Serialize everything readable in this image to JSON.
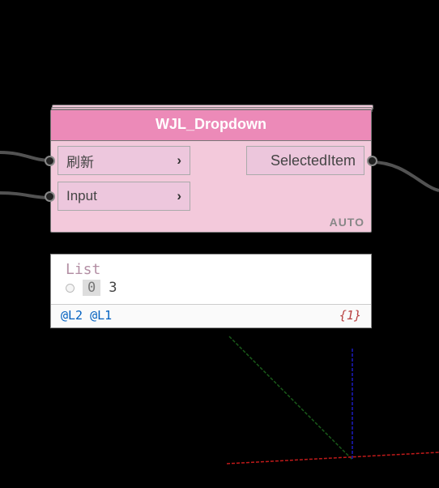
{
  "node": {
    "title": "WJL_Dropdown",
    "inputs": [
      {
        "label": "刷新"
      },
      {
        "label": "Input"
      }
    ],
    "output": {
      "label": "SelectedItem"
    },
    "auto": "AUTO"
  },
  "panel": {
    "list_label": "List",
    "items": [
      {
        "index": "0",
        "value": "3"
      }
    ],
    "annotation_left": "@L2 @L1",
    "annotation_right": "{1}"
  }
}
